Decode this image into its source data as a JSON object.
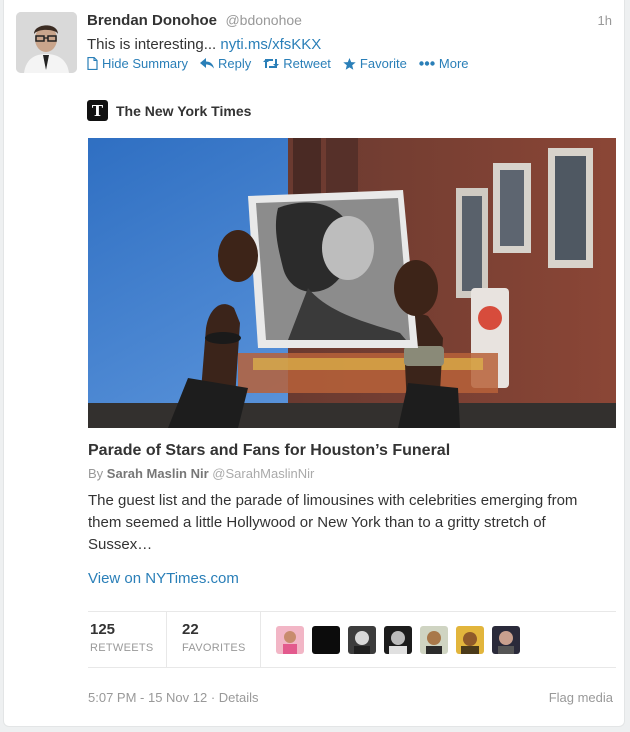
{
  "tweet": {
    "fullname": "Brendan Donohoe",
    "username": "@bdonohoe",
    "time": "1h",
    "text": "This is interesting... ",
    "link_text": "nyti.ms/xfsKKX"
  },
  "actions": [
    {
      "label": "Hide Summary",
      "icon": "document-icon"
    },
    {
      "label": "Reply",
      "icon": "reply-icon"
    },
    {
      "label": "Retweet",
      "icon": "retweet-icon"
    },
    {
      "label": "Favorite",
      "icon": "star-icon"
    },
    {
      "label": "More",
      "icon": "more-dots-icon"
    }
  ],
  "card": {
    "source_logo": "T",
    "source_name": "The New York Times",
    "headline": "Parade of Stars and Fans for Houston’s Funeral",
    "byline_prefix": "By ",
    "author": "Sarah Maslin Nir",
    "author_handle": "@SarahMaslinNir",
    "summary": "The guest list and the parade of limousines with celebrities emerging from them seemed a little Hollywood or New York than to a gritty stretch of Sussex…",
    "view_link": "View on NYTimes.com"
  },
  "stats": {
    "retweets_count": "125",
    "retweets_label": "RETWEETS",
    "favorites_count": "22",
    "favorites_label": "FAVORITES"
  },
  "footer": {
    "timestamp": "5:07 PM - 15 Nov 12 · Details",
    "flag": "Flag media"
  },
  "colors": {
    "link": "#2a7fb8",
    "muted": "#999999",
    "text": "#333333"
  }
}
